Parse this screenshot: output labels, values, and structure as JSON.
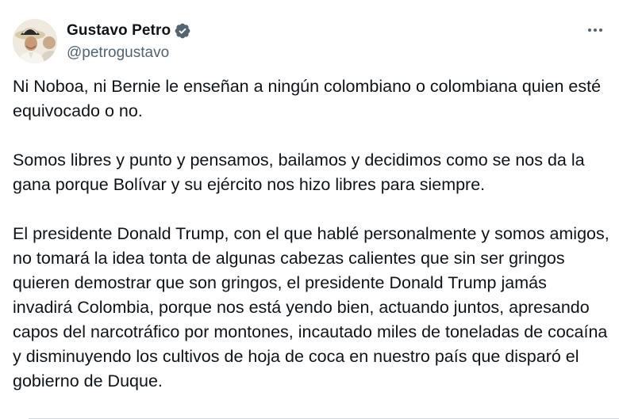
{
  "author": {
    "display_name": "Gustavo Petro",
    "handle": "@petrogustavo",
    "verified": true,
    "verified_color": "#1d9bf0"
  },
  "icons": {
    "verified": "verified-badge-icon",
    "more": "more-options-icon",
    "avatar": "profile-photo"
  },
  "tweet": {
    "paragraphs": [
      "Ni Noboa, ni Bernie le enseñan a ningún colombiano o colombiana quien esté equivocado o no.",
      "Somos libres y punto y pensamos, bailamos y decidimos como se nos da la gana porque Bolívar y su ejército nos hizo libres para siempre.",
      "El presidente Donald Trump, con el que hablé personalmente y somos amigos, no tomará la idea tonta de algunas cabezas calientes que sin ser gringos quieren demostrar que son gringos, el presidente Donald Trump jamás invadirá Colombia, porque nos está yendo bien, actuando juntos, apresando capos del narcotráfico por montones, incautado miles de toneladas de cocaína y disminuyendo los cultivos de hoja de coca en nuestro país que disparó el gobierno de Duque."
    ]
  },
  "colors": {
    "text": "#0f1419",
    "secondary_text": "#536471",
    "divider": "#cfd9de"
  }
}
